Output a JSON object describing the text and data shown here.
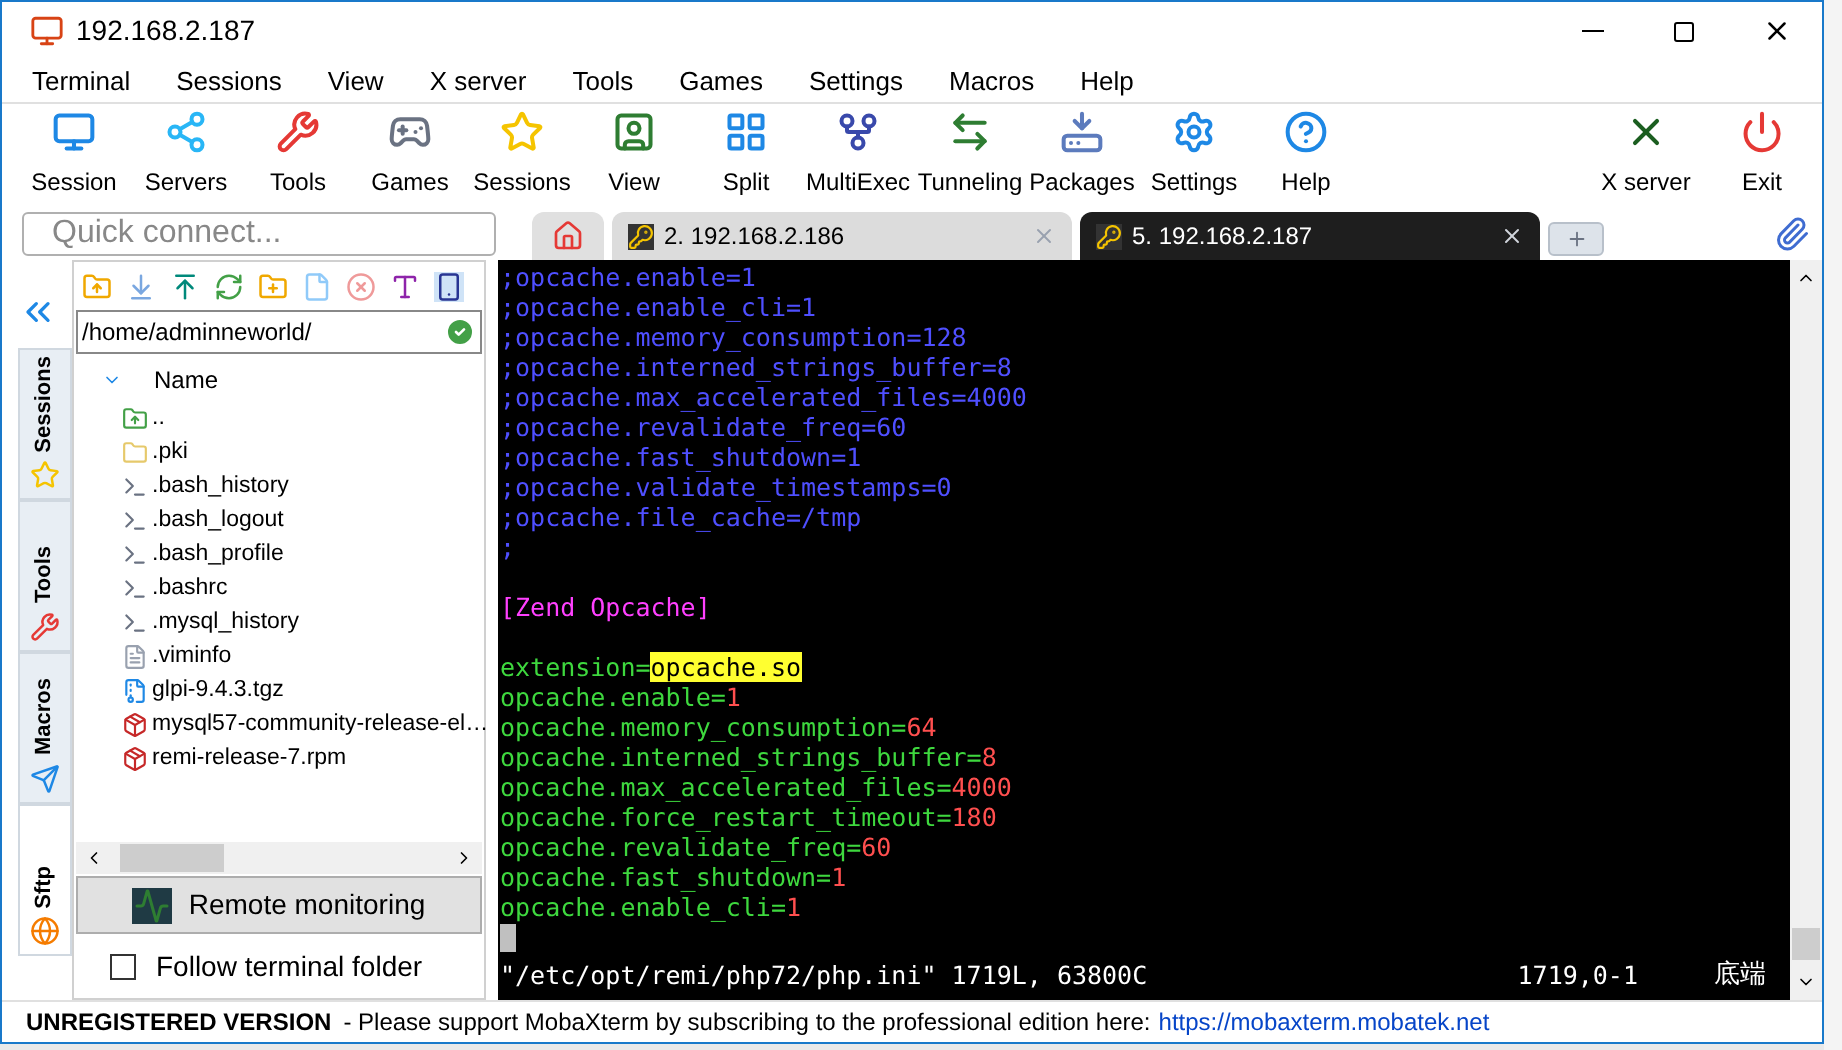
{
  "window": {
    "title": "192.168.2.187"
  },
  "menu": [
    "Terminal",
    "Sessions",
    "View",
    "X server",
    "Tools",
    "Games",
    "Settings",
    "Macros",
    "Help"
  ],
  "toolbar": [
    {
      "label": "Session",
      "kind": "session"
    },
    {
      "label": "Servers",
      "kind": "servers"
    },
    {
      "label": "Tools",
      "kind": "tools"
    },
    {
      "label": "Games",
      "kind": "games"
    },
    {
      "label": "Sessions",
      "kind": "sessions"
    },
    {
      "label": "View",
      "kind": "view"
    },
    {
      "label": "Split",
      "kind": "split"
    },
    {
      "label": "MultiExec",
      "kind": "multiexec"
    },
    {
      "label": "Tunneling",
      "kind": "tunneling"
    },
    {
      "label": "Packages",
      "kind": "packages"
    },
    {
      "label": "Settings",
      "kind": "settings"
    },
    {
      "label": "Help",
      "kind": "help"
    }
  ],
  "toolbar_right": [
    {
      "label": "X server",
      "kind": "xserver"
    },
    {
      "label": "Exit",
      "kind": "exit"
    }
  ],
  "quick_connect": {
    "placeholder": "Quick connect..."
  },
  "tabs": [
    {
      "label": "2. 192.168.2.186",
      "selected": false
    },
    {
      "label": "5. 192.168.2.187",
      "selected": true
    }
  ],
  "side_tabs": [
    {
      "label": "Sessions",
      "kind": "star",
      "selected": false
    },
    {
      "label": "Tools",
      "kind": "tools",
      "selected": false
    },
    {
      "label": "Macros",
      "kind": "plane",
      "selected": false
    },
    {
      "label": "Sftp",
      "kind": "globe",
      "selected": true
    }
  ],
  "sftp": {
    "path": "/home/adminneworld/",
    "column": "Name",
    "files": [
      {
        "name": "..",
        "kind": "parent"
      },
      {
        "name": ".pki",
        "kind": "folder"
      },
      {
        "name": ".bash_history",
        "kind": "term"
      },
      {
        "name": ".bash_logout",
        "kind": "term"
      },
      {
        "name": ".bash_profile",
        "kind": "term"
      },
      {
        "name": ".bashrc",
        "kind": "term"
      },
      {
        "name": ".mysql_history",
        "kind": "term"
      },
      {
        "name": ".viminfo",
        "kind": "text"
      },
      {
        "name": "glpi-9.4.3.tgz",
        "kind": "archive"
      },
      {
        "name": "mysql57-community-release-el…",
        "kind": "rpm"
      },
      {
        "name": "remi-release-7.rpm",
        "kind": "rpm"
      }
    ],
    "monitor_button": "Remote monitoring",
    "follow": {
      "label": "Follow terminal folder",
      "checked": false
    }
  },
  "terminal": {
    "lines": [
      {
        "kind": "text",
        "segments": [
          {
            "text": ";opcache.enable=1",
            "kind": "comment"
          }
        ]
      },
      {
        "kind": "text",
        "segments": [
          {
            "text": ";opcache.enable_cli=1",
            "kind": "comment"
          }
        ]
      },
      {
        "kind": "text",
        "segments": [
          {
            "text": ";opcache.memory_consumption=128",
            "kind": "comment"
          }
        ]
      },
      {
        "kind": "text",
        "segments": [
          {
            "text": ";opcache.interned_strings_buffer=8",
            "kind": "comment"
          }
        ]
      },
      {
        "kind": "text",
        "segments": [
          {
            "text": ";opcache.max_accelerated_files=4000",
            "kind": "comment"
          }
        ]
      },
      {
        "kind": "text",
        "segments": [
          {
            "text": ";opcache.revalidate_freq=60",
            "kind": "comment"
          }
        ]
      },
      {
        "kind": "text",
        "segments": [
          {
            "text": ";opcache.fast_shutdown=1",
            "kind": "comment"
          }
        ]
      },
      {
        "kind": "text",
        "segments": [
          {
            "text": ";opcache.validate_timestamps=0",
            "kind": "comment"
          }
        ]
      },
      {
        "kind": "text",
        "segments": [
          {
            "text": ";opcache.file_cache=/tmp",
            "kind": "comment"
          }
        ]
      },
      {
        "kind": "text",
        "segments": [
          {
            "text": ";",
            "kind": "comment"
          }
        ]
      },
      {
        "kind": "blank"
      },
      {
        "kind": "text",
        "segments": [
          {
            "text": "[Zend Opcache]",
            "kind": "section"
          }
        ]
      },
      {
        "kind": "blank"
      },
      {
        "kind": "text",
        "segments": [
          {
            "text": "extension=",
            "kind": "key"
          },
          {
            "text": "opcache.so",
            "kind": "highlight"
          }
        ]
      },
      {
        "kind": "text",
        "segments": [
          {
            "text": "opcache.enable=",
            "kind": "key"
          },
          {
            "text": "1",
            "kind": "value"
          }
        ]
      },
      {
        "kind": "text",
        "segments": [
          {
            "text": "opcache.memory_consumption=",
            "kind": "key"
          },
          {
            "text": "64",
            "kind": "value"
          }
        ]
      },
      {
        "kind": "text",
        "segments": [
          {
            "text": "opcache.interned_strings_buffer=",
            "kind": "key"
          },
          {
            "text": "8",
            "kind": "value"
          }
        ]
      },
      {
        "kind": "text",
        "segments": [
          {
            "text": "opcache.max_accelerated_files=",
            "kind": "key"
          },
          {
            "text": "4000",
            "kind": "value"
          }
        ]
      },
      {
        "kind": "text",
        "segments": [
          {
            "text": "opcache.force_restart_timeout=",
            "kind": "key"
          },
          {
            "text": "180",
            "kind": "value"
          }
        ]
      },
      {
        "kind": "text",
        "segments": [
          {
            "text": "opcache.revalidate_freq=",
            "kind": "key"
          },
          {
            "text": "60",
            "kind": "value"
          }
        ]
      },
      {
        "kind": "text",
        "segments": [
          {
            "text": "opcache.fast_shutdown=",
            "kind": "key"
          },
          {
            "text": "1",
            "kind": "value"
          }
        ]
      },
      {
        "kind": "text",
        "segments": [
          {
            "text": "opcache.enable_cli=",
            "kind": "key"
          },
          {
            "text": "1",
            "kind": "value"
          }
        ]
      },
      {
        "kind": "cursor"
      }
    ],
    "status": {
      "file": "\"/etc/opt/remi/php72/php.ini\" 1719L, 63800C",
      "position": "1719,0-1",
      "where": "底端"
    }
  },
  "status_bar": {
    "label": "UNREGISTERED VERSION",
    "message": "-  Please support MobaXterm by subscribing to the professional edition here:",
    "link": "https://mobaxterm.mobatek.net"
  }
}
